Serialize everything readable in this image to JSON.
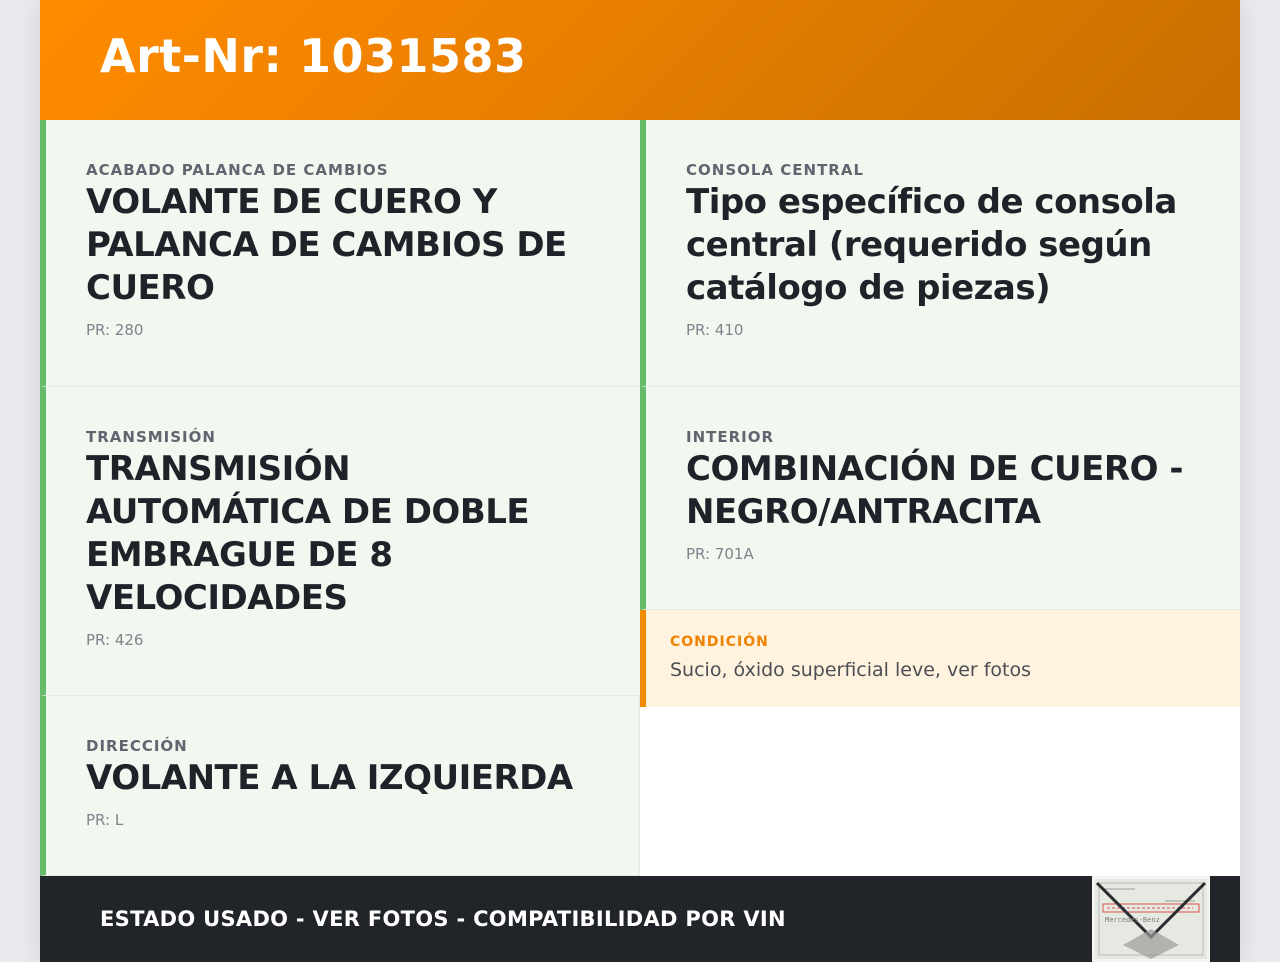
{
  "header": {
    "title": "Art-Nr: 1031583"
  },
  "cards": [
    {
      "label": "ACABADO PALANCA DE CAMBIOS",
      "value": "VOLANTE DE CUERO Y PALANCA DE CAMBIOS DE CUERO",
      "pr": "PR: 280"
    },
    {
      "label": "CONSOLA CENTRAL",
      "value": "Tipo específico de consola central (requerido según catálogo de piezas)",
      "pr": "PR: 410"
    },
    {
      "label": "TRANSMISIÓN",
      "value": "TRANSMISIÓN AUTOMÁTICA DE DOBLE EMBRAGUE DE 8 VELOCIDADES",
      "pr": "PR: 426"
    },
    {
      "label": "INTERIOR",
      "value": "COMBINACIÓN DE CUERO - NEGRO/ANTRACITA",
      "pr": "PR: 701A"
    },
    {
      "label": "DIRECCIÓN",
      "value": "VOLANTE A LA IZQUIERDA",
      "pr": "PR: L"
    }
  ],
  "condition": {
    "label": "CONDICIÓN",
    "text": "Sucio, óxido superficial leve, ver fotos"
  },
  "footer": {
    "text": "ESTADO USADO - VER FOTOS - COMPATIBILIDAD POR VIN"
  },
  "thumbnail": {
    "icon": "envelope-icon",
    "caption": "Mercedes-Benz"
  },
  "colors": {
    "accent": "#ff8c00",
    "card_border": "#66bb6a",
    "card_bg": "#f2f8f0",
    "condition_border": "#f08a00",
    "condition_bg": "#fff2de",
    "footer_bg": "#212429"
  }
}
